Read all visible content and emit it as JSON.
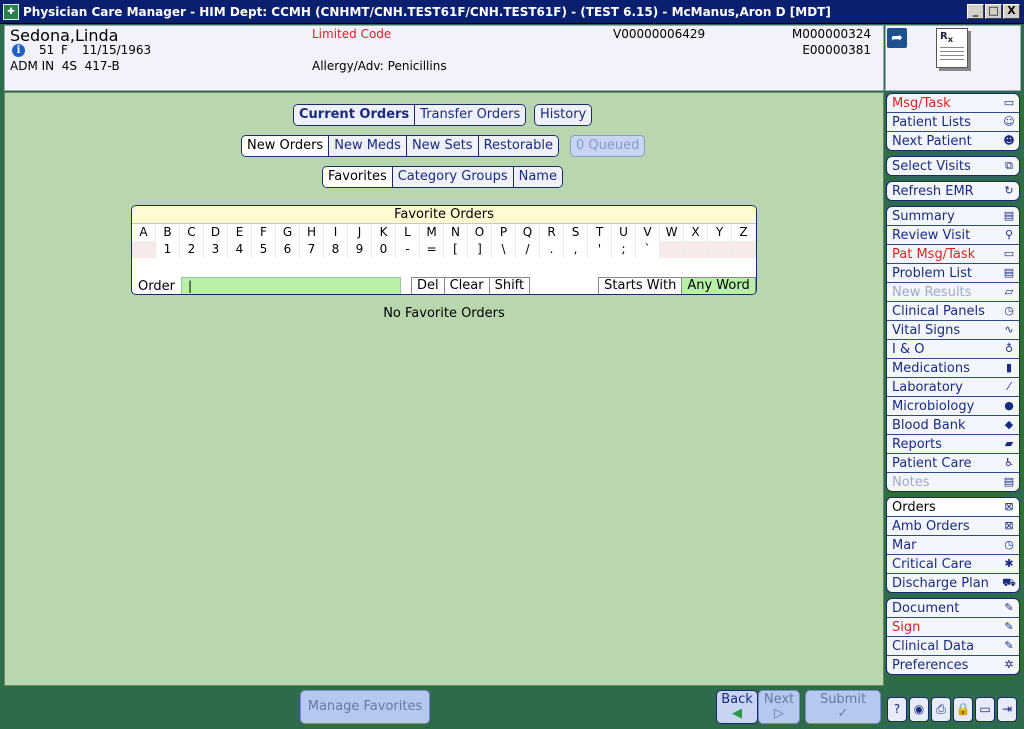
{
  "window": {
    "title": "Physician Care Manager - HIM Dept: CCMH (CNHMT/CNH.TEST61F/CNH.TEST61F) - (TEST 6.15) - McManus,Aron D [MDT]",
    "minimize": "_",
    "maximize": "□",
    "close": "X"
  },
  "patient": {
    "name": "Sedona,Linda",
    "age": "51",
    "sex": "F",
    "dob": "11/15/1963",
    "adm_line": "ADM IN  4S  417-B",
    "limited_code": "Limited Code",
    "allergy": "Allergy/Adv: Penicillins",
    "visit_id": "V00000006429",
    "mrn": "M000000324",
    "enc": "E00000381"
  },
  "orders_tabs": [
    {
      "label": "Current Orders",
      "state": "bold"
    },
    {
      "label": "Transfer Orders",
      "state": ""
    }
  ],
  "history_label": "History",
  "order_types": [
    {
      "label": "New Orders",
      "state": "sel"
    },
    {
      "label": "New Meds",
      "state": ""
    },
    {
      "label": "New Sets",
      "state": ""
    },
    {
      "label": "Restorable",
      "state": ""
    }
  ],
  "queued_label": "0 Queued",
  "fav_tabs": [
    {
      "label": "Favorites",
      "state": "sel"
    },
    {
      "label": "Category Groups",
      "state": ""
    },
    {
      "label": "Name",
      "state": ""
    }
  ],
  "fav_panel": {
    "title": "Favorite Orders",
    "letters": [
      "A",
      "B",
      "C",
      "D",
      "E",
      "F",
      "G",
      "H",
      "I",
      "J",
      "K",
      "L",
      "M",
      "N",
      "O",
      "P",
      "Q",
      "R",
      "S",
      "T",
      "U",
      "V",
      "W",
      "X",
      "Y",
      "Z"
    ],
    "symbols": [
      "",
      "1",
      "2",
      "3",
      "4",
      "5",
      "6",
      "7",
      "8",
      "9",
      "0",
      "-",
      "=",
      "[",
      "]",
      "\\",
      "/",
      ".",
      ",",
      "'",
      ";",
      "`",
      "",
      "",
      "",
      ""
    ],
    "order_label": "Order",
    "order_value": "|",
    "del": "Del",
    "clear": "Clear",
    "shift": "Shift",
    "starts_with": "Starts With",
    "any_word": "Any Word"
  },
  "no_favorites": "No Favorite Orders",
  "sidebar": {
    "groups": [
      [
        {
          "label": "Msg/Task",
          "state": "red",
          "icon": "msg-icon",
          "glyph": "▭"
        },
        {
          "label": "Patient Lists",
          "state": "",
          "icon": "patient-lists-icon",
          "glyph": "☺"
        },
        {
          "label": "Next Patient",
          "state": "",
          "icon": "next-patient-icon",
          "glyph": "☻"
        }
      ],
      [
        {
          "label": "Select Visits",
          "state": "",
          "icon": "select-visits-icon",
          "glyph": "⧉"
        }
      ],
      [
        {
          "label": "Refresh EMR",
          "state": "",
          "icon": "refresh-icon",
          "glyph": "↻"
        }
      ],
      [
        {
          "label": "Summary",
          "state": "",
          "icon": "folder-icon",
          "glyph": "▤"
        },
        {
          "label": "Review Visit",
          "state": "",
          "icon": "review-icon",
          "glyph": "⚲"
        },
        {
          "label": "Pat Msg/Task",
          "state": "red",
          "icon": "pat-msg-icon",
          "glyph": "▭"
        },
        {
          "label": "Problem List",
          "state": "",
          "icon": "problem-list-icon",
          "glyph": "▤"
        },
        {
          "label": "New Results",
          "state": "dim",
          "icon": "new-results-icon",
          "glyph": "▱"
        },
        {
          "label": "Clinical Panels",
          "state": "",
          "icon": "clinical-panels-icon",
          "glyph": "◷"
        },
        {
          "label": "Vital Signs",
          "state": "",
          "icon": "vital-signs-icon",
          "glyph": "∿"
        },
        {
          "label": "I & O",
          "state": "",
          "icon": "drop-icon",
          "glyph": "♁"
        },
        {
          "label": "Medications",
          "state": "",
          "icon": "medications-icon",
          "glyph": "▮"
        },
        {
          "label": "Laboratory",
          "state": "",
          "icon": "laboratory-icon",
          "glyph": "⁄"
        },
        {
          "label": "Microbiology",
          "state": "",
          "icon": "microbiology-icon",
          "glyph": "●"
        },
        {
          "label": "Blood Bank",
          "state": "",
          "icon": "blood-bank-icon",
          "glyph": "◆"
        },
        {
          "label": "Reports",
          "state": "",
          "icon": "reports-icon",
          "glyph": "▰"
        },
        {
          "label": "Patient Care",
          "state": "",
          "icon": "patient-care-icon",
          "glyph": "♿"
        },
        {
          "label": "Notes",
          "state": "dim",
          "icon": "notes-icon",
          "glyph": "▤"
        }
      ],
      [
        {
          "label": "Orders",
          "state": "sel",
          "icon": "orders-icon",
          "glyph": "⊠"
        },
        {
          "label": "Amb Orders",
          "state": "",
          "icon": "amb-orders-icon",
          "glyph": "⊠"
        },
        {
          "label": "Mar",
          "state": "",
          "icon": "mar-icon",
          "glyph": "◷"
        },
        {
          "label": "Critical Care",
          "state": "",
          "icon": "critical-care-icon",
          "glyph": "✱"
        },
        {
          "label": "Discharge Plan",
          "state": "",
          "icon": "discharge-icon",
          "glyph": "⛟"
        }
      ],
      [
        {
          "label": "Document",
          "state": "",
          "icon": "pen-icon",
          "glyph": "✎"
        },
        {
          "label": "Sign",
          "state": "red",
          "icon": "sign-icon",
          "glyph": "✎"
        },
        {
          "label": "Clinical Data",
          "state": "",
          "icon": "clinical-data-icon",
          "glyph": "✎"
        },
        {
          "label": "Preferences",
          "state": "",
          "icon": "gear-icon",
          "glyph": "✲"
        }
      ]
    ]
  },
  "bottom": {
    "manage_favorites": "Manage Favorites",
    "back": "Back",
    "next": "Next",
    "submit": "Submit",
    "back_glyph": "◀",
    "next_glyph": "▷",
    "submit_glyph": "✓"
  }
}
